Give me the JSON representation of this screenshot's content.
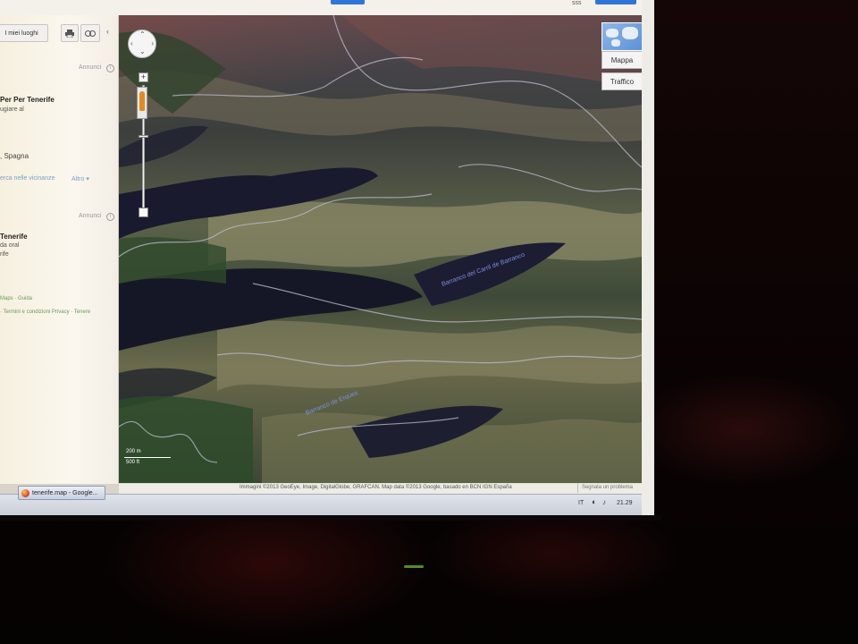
{
  "topbar": {
    "right_text": "sss"
  },
  "left_panel": {
    "my_places_button": "I miei luoghi",
    "print_icon": "print-icon",
    "link_icon": "link-icon",
    "collapse_arrow": "‹",
    "ads_label_1": "Annunci",
    "ad_title_1": "Per Tenerife",
    "ad_text_1": "ugiare al",
    "region_text": ", Spagna",
    "search_nearby": "erca nelle vicinanze",
    "more_link": "Altro ▾",
    "ads_label_2": "Annunci",
    "ad_title_2": "Tenerife",
    "ad_text_2a": "da oral",
    "ad_text_2b": "rife",
    "footer_links_1": "Maps · Guida",
    "footer_links_2": "· Termini e condizioni Privacy · Tenere"
  },
  "map": {
    "road_label_1": "Barranco del Carril de Barranco",
    "road_label_2": "Barranco de Erques",
    "map_type_mappa": "Mappa",
    "map_type_traffico": "Traffico",
    "scale_metric": "200 m",
    "scale_imperial": "500 ft",
    "attribution": "Immagini ©2013 GeoEye, Image, DigitalGlobe, GRAFCAN. Map data ©2013 Google, basado en BCN IGN España",
    "report_problem": "Segnala un problema"
  },
  "taskbar": {
    "task_label": "tenerife.map - Google...",
    "tray_lang": "IT",
    "tray_time": "21.29"
  },
  "colors": {
    "accent_blue": "#2f74d8",
    "peg_orange": "#e58a1f",
    "road_label": "#7f8fd8"
  }
}
